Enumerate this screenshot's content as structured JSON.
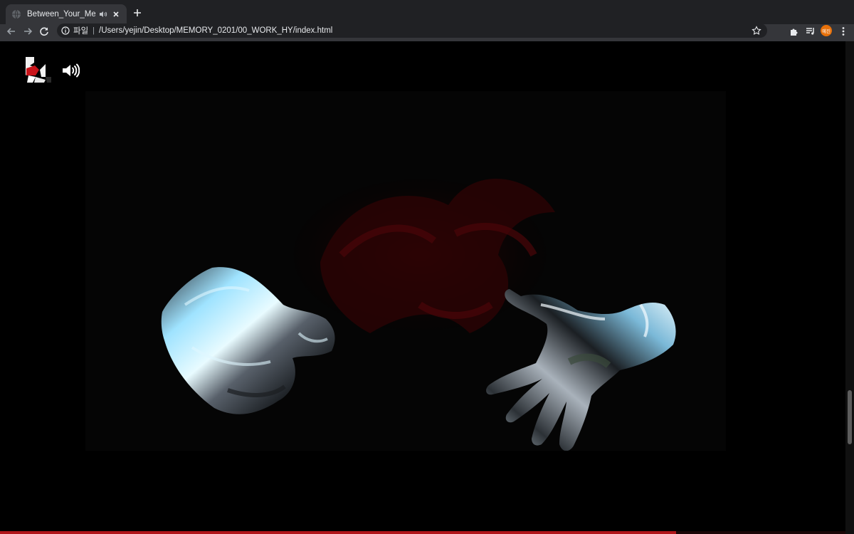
{
  "browser": {
    "tab": {
      "title": "Between_Your_Memories",
      "favicon": "globe-icon",
      "audio_icon": "speaker-icon",
      "close_icon": "close-icon"
    },
    "new_tab_icon": "plus-icon",
    "nav": {
      "back_icon": "arrow-left-icon",
      "forward_icon": "arrow-right-icon",
      "reload_icon": "reload-icon"
    },
    "address_bar": {
      "info_icon": "info-icon",
      "scheme_label": "파일",
      "separator": "|",
      "url": "/Users/yejin/Desktop/MEMORY_0201/00_WORK_HY/index.html",
      "bookmark_icon": "star-icon"
    },
    "toolbar_icons": [
      "puzzle-icon",
      "media-queue-icon",
      "kebab-menu-icon"
    ],
    "profile": {
      "initials": "예진",
      "color": "#e8710a"
    },
    "colors": {
      "tabbar": "#202124",
      "toolbar": "#35363a",
      "text": "#e8eaed"
    }
  },
  "page": {
    "background": "#000000",
    "logo_icon": "brand-logo-icon",
    "sound_icon": "volume-icon",
    "scene": {
      "left_object": "chrome-fist-icon",
      "right_object": "chrome-open-hand-icon",
      "backdrop": "red-smoke-icon"
    },
    "bottom_progress": 0.8,
    "accent_color": "#b0161a",
    "scroll_position": 0.82
  }
}
